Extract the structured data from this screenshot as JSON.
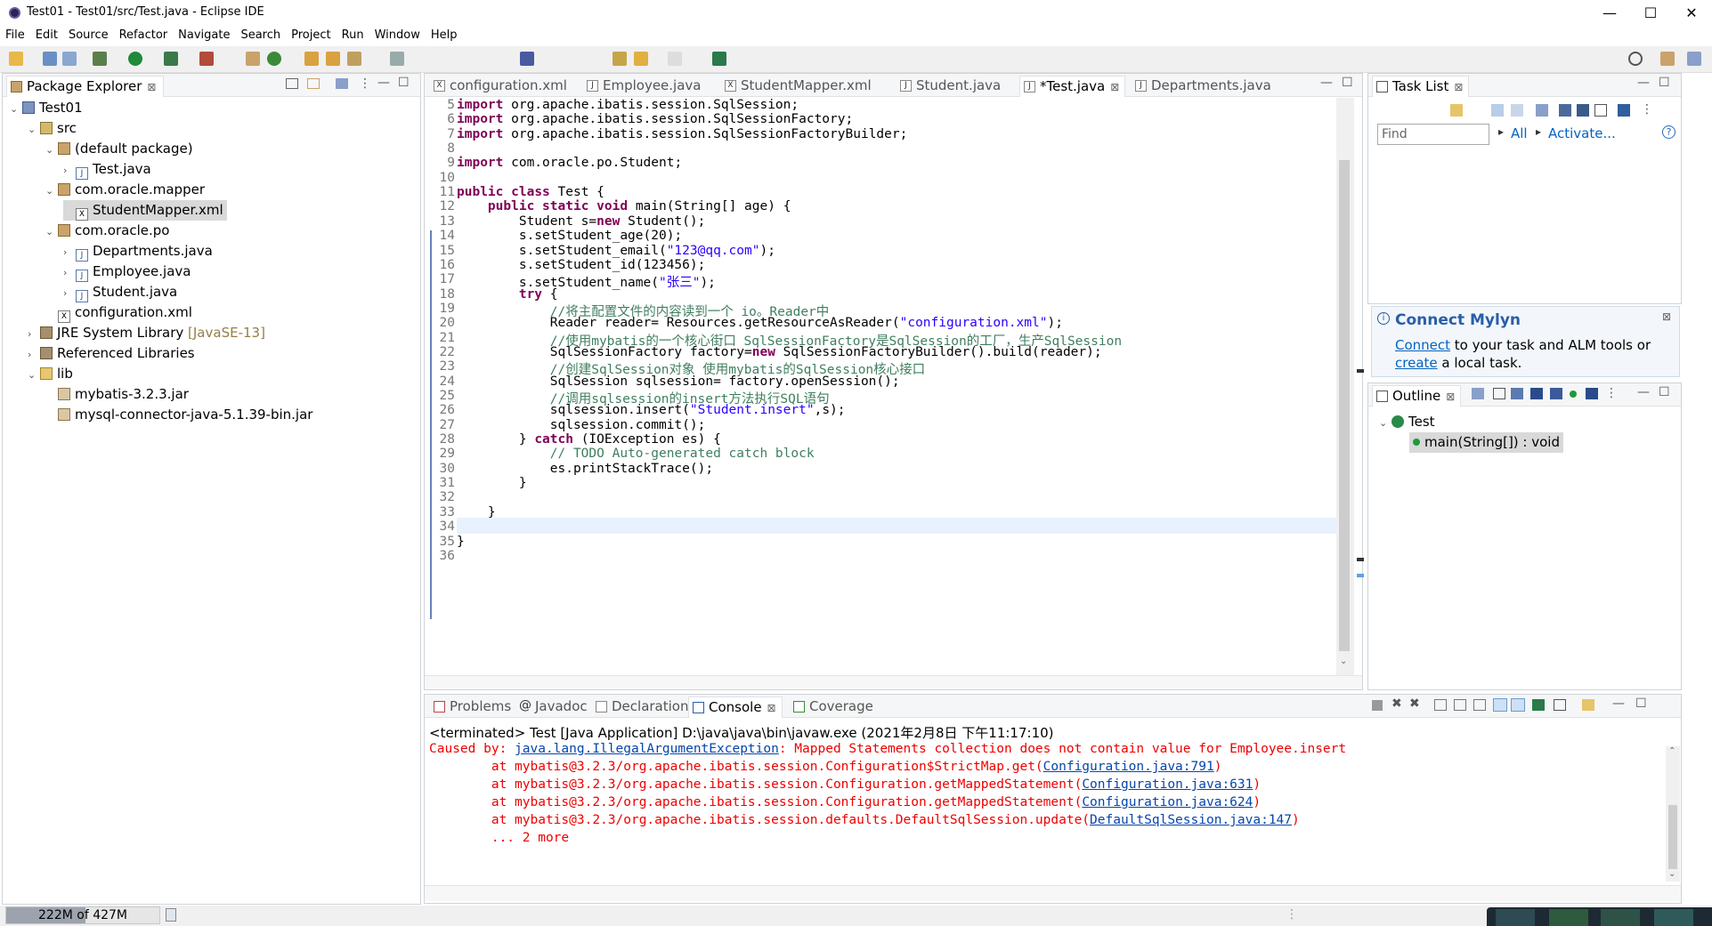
{
  "window": {
    "title": "Test01 - Test01/src/Test.java - Eclipse IDE",
    "minimize": "—",
    "maximize": "☐",
    "close": "✕"
  },
  "menu": [
    "File",
    "Edit",
    "Source",
    "Refactor",
    "Navigate",
    "Search",
    "Project",
    "Run",
    "Window",
    "Help"
  ],
  "package_explorer": {
    "title": "Package Explorer",
    "tree": [
      {
        "label": "Test01",
        "icon": "project-icon"
      },
      {
        "label": "src",
        "icon": "source-folder-icon"
      },
      {
        "label": "(default package)",
        "icon": "package-icon"
      },
      {
        "label": "Test.java",
        "icon": "java-file-icon"
      },
      {
        "label": "com.oracle.mapper",
        "icon": "package-icon"
      },
      {
        "label": "StudentMapper.xml",
        "icon": "xml-file-icon"
      },
      {
        "label": "com.oracle.po",
        "icon": "package-icon"
      },
      {
        "label": "Departments.java",
        "icon": "java-file-icon"
      },
      {
        "label": "Employee.java",
        "icon": "java-file-icon"
      },
      {
        "label": "Student.java",
        "icon": "java-file-icon"
      },
      {
        "label": "configuration.xml",
        "icon": "xml-file-icon"
      },
      {
        "label": "JRE System Library",
        "suffix": "[JavaSE-13]",
        "icon": "library-icon"
      },
      {
        "label": "Referenced Libraries",
        "icon": "library-icon"
      },
      {
        "label": "lib",
        "icon": "folder-icon"
      },
      {
        "label": "mybatis-3.2.3.jar",
        "icon": "jar-icon"
      },
      {
        "label": "mysql-connector-java-5.1.39-bin.jar",
        "icon": "jar-icon"
      }
    ]
  },
  "editor": {
    "tabs": [
      "configuration.xml",
      "Employee.java",
      "StudentMapper.xml",
      "Student.java",
      "*Test.java",
      "Departments.java"
    ],
    "active_tab": "*Test.java",
    "line_numbers": [
      "5",
      "6",
      "7",
      "8",
      "9",
      "10",
      "11",
      "12",
      "13",
      "14",
      "15",
      "16",
      "17",
      "18",
      "19",
      "20",
      "21",
      "22",
      "23",
      "24",
      "25",
      "26",
      "27",
      "28",
      "29",
      "30",
      "31",
      "32",
      "33",
      "34",
      "35",
      "36"
    ],
    "lines": [
      "import org.apache.ibatis.session.SqlSession;",
      "import org.apache.ibatis.session.SqlSessionFactory;",
      "import org.apache.ibatis.session.SqlSessionFactoryBuilder;",
      "",
      "import com.oracle.po.Student;",
      "",
      "public class Test {",
      "    public static void main(String[] age) {",
      "        Student s=new Student();",
      "        s.setStudent_age(20);",
      "        s.setStudent_email(\"123@qq.com\");",
      "        s.setStudent_id(123456);",
      "        s.setStudent_name(\"张三\");",
      "        try {",
      "            //将主配置文件的内容读到一个 io。Reader中",
      "            Reader reader= Resources.getResourceAsReader(\"configuration.xml\");",
      "            //使用mybatis的一个核心街口 SqlSessionFactory是SqlSession的工厂，生产SqlSession",
      "            SqlSessionFactory factory=new SqlSessionFactoryBuilder().build(reader);",
      "            //创建SqlSession对象 使用mybatis的SqlSession核心接口",
      "            SqlSession sqlsession= factory.openSession();",
      "            //调用sqlsession的insert方法执行SQL语句",
      "            sqlsession.insert(\"Student.insert\",s);",
      "            sqlsession.commit();",
      "        } catch (IOException es) {",
      "            // TODO Auto-generated catch block",
      "            es.printStackTrace();",
      "        }",
      "",
      "    }",
      "",
      "}",
      ""
    ]
  },
  "task_list": {
    "title": "Task List",
    "find_placeholder": "Find",
    "all_label": "All",
    "activate_label": "Activate..."
  },
  "mylyn": {
    "title": "Connect Mylyn",
    "connect_link": "Connect",
    "text1": " to your task and ALM tools or",
    "create_link": "create",
    "text2": " a local task."
  },
  "outline": {
    "title": "Outline",
    "class_name": "Test",
    "method": "main(String[]) : void"
  },
  "bottom_panel": {
    "tabs": [
      "Problems",
      "Javadoc",
      "Declaration",
      "Console",
      "Coverage"
    ],
    "active_tab": "Console",
    "terminated": "<terminated> Test [Java Application] D:\\java\\java\\bin\\javaw.exe (2021年2月8日 下午11:17:10)",
    "error_prefix": "Caused by: ",
    "error_link": "java.lang.IllegalArgumentException",
    "error_msg": ": Mapped Statements collection does not contain value for Employee.insert",
    "stack": [
      {
        "text": "        at mybatis@3.2.3/org.apache.ibatis.session.Configuration$StrictMap.get(",
        "link": "Configuration.java:791",
        "end": ")"
      },
      {
        "text": "        at mybatis@3.2.3/org.apache.ibatis.session.Configuration.getMappedStatement(",
        "link": "Configuration.java:631",
        "end": ")"
      },
      {
        "text": "        at mybatis@3.2.3/org.apache.ibatis.session.Configuration.getMappedStatement(",
        "link": "Configuration.java:624",
        "end": ")"
      },
      {
        "text": "        at mybatis@3.2.3/org.apache.ibatis.session.defaults.DefaultSqlSession.update(",
        "link": "DefaultSqlSession.java:147",
        "end": ")"
      }
    ],
    "more": "        ... 2 more"
  },
  "status_bar": {
    "heap": "222M of 427M",
    "heap_fraction": 0.52
  },
  "colors": {
    "keyword": "#7f0055",
    "string": "#2a00ff",
    "comment": "#3f7f5f",
    "error": "#ff0000",
    "link": "#0645ad"
  }
}
